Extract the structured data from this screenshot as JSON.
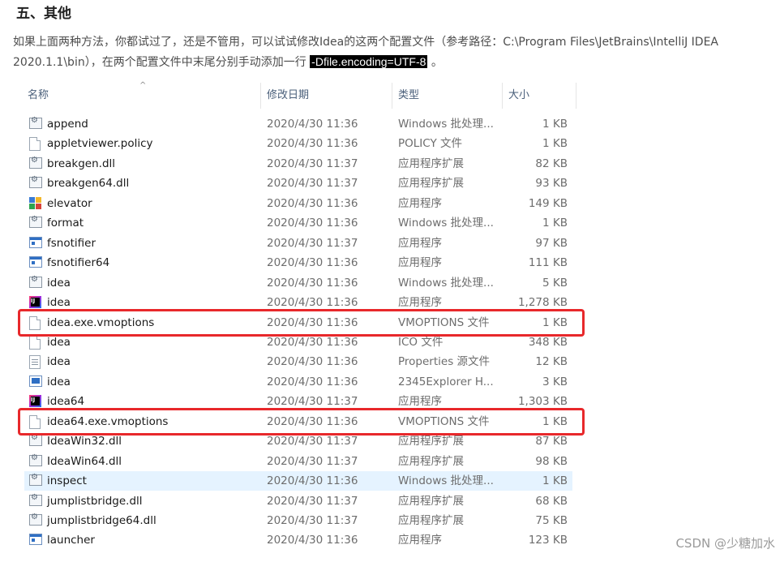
{
  "article": {
    "heading": "五、其他",
    "para_before_path": "如果上面两种方法，你都试过了，还是不管用，可以试试修改Idea的这两个配置文件（参考路径：",
    "path": "C:\\Program Files\\JetBrains\\IntelliJ IDEA 2020.1.1\\bin",
    "para_after_path": "），在两个配置文件中末尾分别手动添加一行",
    "code": "-Dfile.encoding=UTF-8",
    "para_end": "。"
  },
  "explorer": {
    "columns": {
      "name": "名称",
      "date": "修改日期",
      "type": "类型",
      "size": "大小"
    },
    "files": [
      {
        "icon": "gear-file-icon",
        "name": "append",
        "date": "2020/4/30 11:36",
        "type": "Windows 批处理...",
        "size": "1 KB"
      },
      {
        "icon": "blank-file-icon",
        "name": "appletviewer.policy",
        "date": "2020/4/30 11:36",
        "type": "POLICY 文件",
        "size": "1 KB"
      },
      {
        "icon": "gear-file-icon",
        "name": "breakgen.dll",
        "date": "2020/4/30 11:37",
        "type": "应用程序扩展",
        "size": "82 KB"
      },
      {
        "icon": "gear-file-icon",
        "name": "breakgen64.dll",
        "date": "2020/4/30 11:37",
        "type": "应用程序扩展",
        "size": "93 KB"
      },
      {
        "icon": "elevator-app-icon",
        "name": "elevator",
        "date": "2020/4/30 11:36",
        "type": "应用程序",
        "size": "149 KB"
      },
      {
        "icon": "gear-file-icon",
        "name": "format",
        "date": "2020/4/30 11:36",
        "type": "Windows 批处理...",
        "size": "1 KB"
      },
      {
        "icon": "app-window-icon",
        "name": "fsnotifier",
        "date": "2020/4/30 11:37",
        "type": "应用程序",
        "size": "97 KB"
      },
      {
        "icon": "app-window-icon",
        "name": "fsnotifier64",
        "date": "2020/4/30 11:36",
        "type": "应用程序",
        "size": "111 KB"
      },
      {
        "icon": "gear-file-icon",
        "name": "idea",
        "date": "2020/4/30 11:36",
        "type": "Windows 批处理...",
        "size": "5 KB"
      },
      {
        "icon": "intellij-idea-icon",
        "name": "idea",
        "date": "2020/4/30 11:36",
        "type": "应用程序",
        "size": "1,278 KB"
      },
      {
        "icon": "blank-file-icon",
        "name": "idea.exe.vmoptions",
        "date": "2020/4/30 11:36",
        "type": "VMOPTIONS 文件",
        "size": "1 KB"
      },
      {
        "icon": "blank-file-icon",
        "name": "idea",
        "date": "2020/4/30 11:36",
        "type": "ICO 文件",
        "size": "348 KB"
      },
      {
        "icon": "properties-file-icon",
        "name": "idea",
        "date": "2020/4/30 11:36",
        "type": "Properties 源文件",
        "size": "12 KB"
      },
      {
        "icon": "browser-file-icon",
        "name": "idea",
        "date": "2020/4/30 11:36",
        "type": "2345Explorer H...",
        "size": "3 KB"
      },
      {
        "icon": "intellij-idea-icon",
        "name": "idea64",
        "date": "2020/4/30 11:37",
        "type": "应用程序",
        "size": "1,303 KB"
      },
      {
        "icon": "blank-file-icon",
        "name": "idea64.exe.vmoptions",
        "date": "2020/4/30 11:36",
        "type": "VMOPTIONS 文件",
        "size": "1 KB"
      },
      {
        "icon": "gear-file-icon",
        "name": "IdeaWin32.dll",
        "date": "2020/4/30 11:37",
        "type": "应用程序扩展",
        "size": "87 KB"
      },
      {
        "icon": "gear-file-icon",
        "name": "IdeaWin64.dll",
        "date": "2020/4/30 11:37",
        "type": "应用程序扩展",
        "size": "98 KB"
      },
      {
        "icon": "gear-file-icon",
        "name": "inspect",
        "date": "2020/4/30 11:36",
        "type": "Windows 批处理...",
        "size": "1 KB"
      },
      {
        "icon": "gear-file-icon",
        "name": "jumplistbridge.dll",
        "date": "2020/4/30 11:37",
        "type": "应用程序扩展",
        "size": "68 KB"
      },
      {
        "icon": "gear-file-icon",
        "name": "jumplistbridge64.dll",
        "date": "2020/4/30 11:37",
        "type": "应用程序扩展",
        "size": "75 KB"
      },
      {
        "icon": "app-window-icon",
        "name": "launcher",
        "date": "2020/4/30 11:36",
        "type": "应用程序",
        "size": "123 KB"
      }
    ],
    "selected_index": 18,
    "highlighted_indices": [
      10,
      15
    ],
    "highlight_color": "#e8282b",
    "selection_color": "#e5f3ff"
  },
  "watermark": "CSDN @少糖加水"
}
